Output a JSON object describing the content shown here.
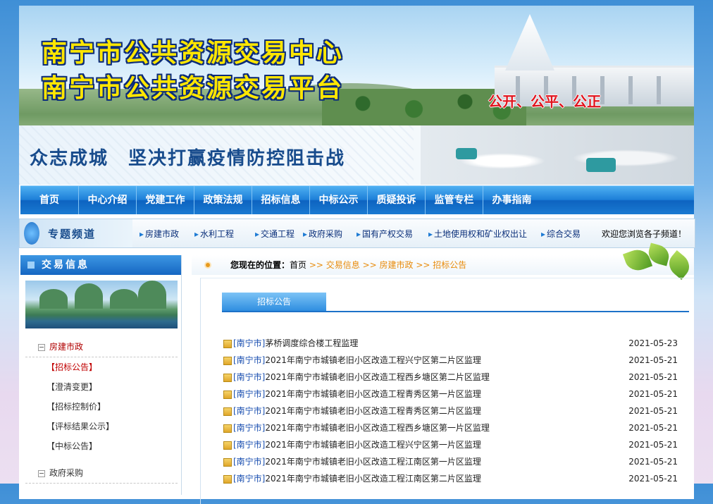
{
  "banner": {
    "title1": "南宁市公共资源交易中心",
    "title2": "南宁市公共资源交易平台",
    "slogan": "公开、公平、公正"
  },
  "subbanner": {
    "text": "众志成城　坚决打赢疫情防控阻击战"
  },
  "nav": [
    "首页",
    "中心介绍",
    "党建工作",
    "政策法规",
    "招标信息",
    "中标公示",
    "质疑投诉",
    "监管专栏",
    "办事指南"
  ],
  "topic": {
    "label": "专题频道",
    "links": [
      "房建市政",
      "水利工程",
      "交通工程",
      "政府采购",
      "国有产权交易",
      "土地使用权和矿业权出让",
      "综合交易"
    ],
    "welcome": "欢迎您浏览各子频道！"
  },
  "sidebar": {
    "title": "交易信息",
    "category1": "房建市政",
    "items": [
      "【招标公告】",
      "【澄清变更】",
      "【招标控制价】",
      "【评标结果公示】",
      "【中标公告】"
    ],
    "category2": "政府采购"
  },
  "breadcrumb": {
    "label": "您现在的位置：",
    "home": "首页",
    "path": " >> 交易信息 >> 房建市政 >> 招标公告"
  },
  "tab": "招标公告",
  "list": [
    {
      "prefix": "[南宁市]",
      "title": "茅桥调度综合楼工程监理",
      "date": "2021-05-23"
    },
    {
      "prefix": "[南宁市]",
      "title": "2021年南宁市城镇老旧小区改造工程兴宁区第二片区监理",
      "date": "2021-05-21"
    },
    {
      "prefix": "[南宁市]",
      "title": "2021年南宁市城镇老旧小区改造工程西乡塘区第二片区监理",
      "date": "2021-05-21"
    },
    {
      "prefix": "[南宁市]",
      "title": "2021年南宁市城镇老旧小区改造工程青秀区第一片区监理",
      "date": "2021-05-21"
    },
    {
      "prefix": "[南宁市]",
      "title": "2021年南宁市城镇老旧小区改造工程青秀区第二片区监理",
      "date": "2021-05-21"
    },
    {
      "prefix": "[南宁市]",
      "title": "2021年南宁市城镇老旧小区改造工程西乡塘区第一片区监理",
      "date": "2021-05-21"
    },
    {
      "prefix": "[南宁市]",
      "title": "2021年南宁市城镇老旧小区改造工程兴宁区第一片区监理",
      "date": "2021-05-21"
    },
    {
      "prefix": "[南宁市]",
      "title": "2021年南宁市城镇老旧小区改造工程江南区第一片区监理",
      "date": "2021-05-21"
    },
    {
      "prefix": "[南宁市]",
      "title": "2021年南宁市城镇老旧小区改造工程江南区第二片区监理",
      "date": "2021-05-21"
    }
  ]
}
